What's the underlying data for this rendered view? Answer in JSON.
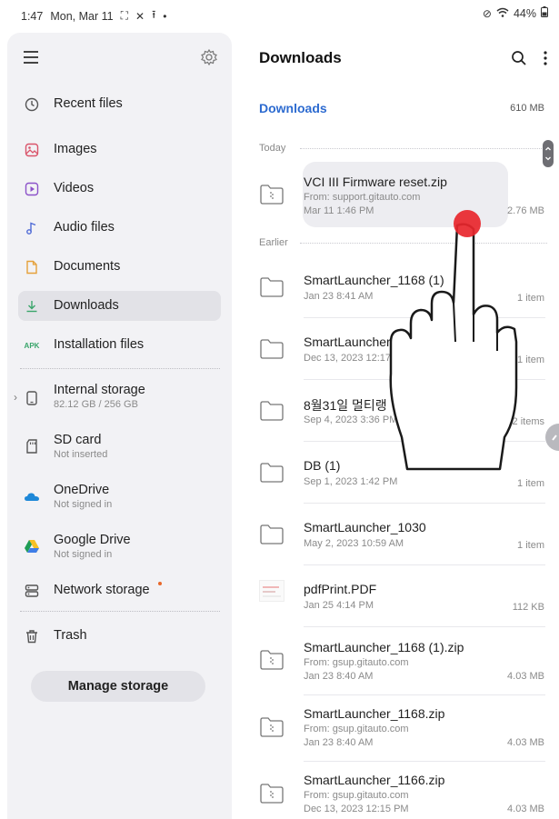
{
  "status_bar": {
    "time": "1:47",
    "date": "Mon, Mar 11",
    "battery": "44%",
    "left_icons": [
      "screenshot-icon",
      "tools-icon",
      "upload-icon"
    ],
    "right_icons": [
      "mute-icon",
      "vibrate-icon",
      "wifi-icon"
    ]
  },
  "sidebar": {
    "items": [
      {
        "label": "Recent files",
        "icon": "clock-icon"
      },
      {
        "label": "Images",
        "icon": "image-icon",
        "color": "#d9546a"
      },
      {
        "label": "Videos",
        "icon": "video-icon",
        "color": "#8c52c9"
      },
      {
        "label": "Audio files",
        "icon": "music-icon",
        "color": "#4f6bd6"
      },
      {
        "label": "Documents",
        "icon": "document-icon",
        "color": "#e5a13a"
      },
      {
        "label": "Downloads",
        "icon": "download-icon",
        "color": "#3aa56b",
        "active": true
      },
      {
        "label": "Installation files",
        "icon": "apk-icon",
        "icon_text": "APK",
        "color": "#3aa56b"
      }
    ],
    "storage": [
      {
        "label": "Internal storage",
        "sub": "82.12 GB / 256 GB",
        "icon": "phone-icon"
      },
      {
        "label": "SD card",
        "sub": "Not inserted",
        "icon": "sdcard-icon"
      },
      {
        "label": "OneDrive",
        "sub": "Not signed in",
        "icon": "onedrive-icon",
        "color": "#1e88d8"
      },
      {
        "label": "Google Drive",
        "sub": "Not signed in",
        "icon": "google-drive-icon"
      },
      {
        "label": "Network storage",
        "icon": "network-storage-icon"
      }
    ],
    "trash_label": "Trash",
    "manage_storage_label": "Manage storage"
  },
  "main": {
    "title": "Downloads",
    "breadcrumb": "Downloads",
    "storage_size": "610 MB",
    "accent_color": "#2d6bd0",
    "sections": {
      "today": "Today",
      "earlier": "Earlier"
    },
    "files": [
      {
        "name": "VCI III Firmware reset.zip",
        "from": "From: support.gitauto.com",
        "date": "Mar 11 1:46 PM",
        "size": "2.76 MB",
        "type": "zip"
      },
      {
        "name": "SmartLauncher_1168 (1)",
        "date": "Jan 23 8:41 AM",
        "size": "1 item",
        "type": "folder"
      },
      {
        "name": "SmartLauncher_",
        "date": "Dec 13, 2023 12:17",
        "size": "1 item",
        "type": "folder"
      },
      {
        "name": "8월31일 멀티랭",
        "date": "Sep 4, 2023 3:36 PM",
        "size": "2 items",
        "type": "folder"
      },
      {
        "name": "DB (1)",
        "date": "Sep 1, 2023 1:42 PM",
        "size": "1 item",
        "type": "folder"
      },
      {
        "name": "SmartLauncher_1030",
        "date": "May 2, 2023 10:59 AM",
        "size": "1 item",
        "type": "folder"
      },
      {
        "name": "pdfPrint.PDF",
        "date": "Jan 25 4:14 PM",
        "size": "112 KB",
        "type": "pdf"
      },
      {
        "name": "SmartLauncher_1168 (1).zip",
        "from": "From: gsup.gitauto.com",
        "date": "Jan 23 8:40 AM",
        "size": "4.03 MB",
        "type": "zip"
      },
      {
        "name": "SmartLauncher_1168.zip",
        "from": "From: gsup.gitauto.com",
        "date": "Jan 23 8:40 AM",
        "size": "4.03 MB",
        "type": "zip"
      },
      {
        "name": "SmartLauncher_1166.zip",
        "from": "From: gsup.gitauto.com",
        "date": "Dec 13, 2023 12:15 PM",
        "size": "4.03 MB",
        "type": "zip"
      }
    ]
  },
  "touch_indicator_color": "#e8262d"
}
